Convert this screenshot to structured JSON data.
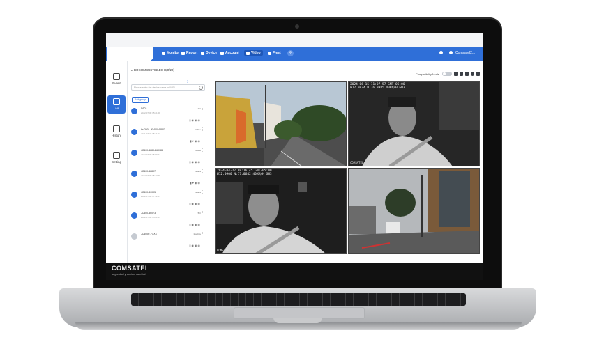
{
  "nav": {
    "items": [
      {
        "label": "Monitor",
        "icon": "monitor-icon"
      },
      {
        "label": "Report",
        "icon": "report-icon"
      },
      {
        "label": "Device",
        "icon": "device-icon"
      },
      {
        "label": "Account",
        "icon": "account-icon"
      },
      {
        "label": "Video",
        "icon": "video-icon",
        "active": true
      },
      {
        "label": "Fleet",
        "icon": "fleet-icon"
      }
    ],
    "user": "Comsatel2...",
    "accent": "#2f6fd8"
  },
  "rail": {
    "items": [
      {
        "label": "Event",
        "icon": "event-icon"
      },
      {
        "label": "Live",
        "icon": "live-icon",
        "active": true
      },
      {
        "label": "History",
        "icon": "history-icon"
      },
      {
        "label": "Setting",
        "icon": "setting-icon"
      }
    ]
  },
  "panel": {
    "title": "BOCOMBUSTIBLES H(0/20)",
    "search_placeholder": "Please enter the device name or IMEI",
    "add_group": "Add group",
    "devices": [
      {
        "name": "D302",
        "date": "2022-07-30 15:21:08",
        "status": "2hr"
      },
      {
        "name": "hrz2001-JC400-48843",
        "date": "2021-07-27 15:11:44",
        "status": "Offline"
      },
      {
        "name": "JC400-48804-60088",
        "date": "2022-07-30 15:59:21",
        "status": "Online"
      },
      {
        "name": "JC400-48807",
        "date": "2022-07-30 15:43:38",
        "status": "5days"
      },
      {
        "name": "JC400-80005",
        "date": "2022-07-30 17:42:07",
        "status": "5days"
      },
      {
        "name": "JC400-46073",
        "date": "2022-07-30 15:21:05",
        "status": "5hr"
      },
      {
        "name": "JC400P-YXXX",
        "date": "",
        "status": "Inactive"
      }
    ]
  },
  "video": {
    "compat_label": "Compatibility Mode",
    "watermark": "COMSATEL",
    "tiles": [
      {
        "timestamp": "",
        "label": "street-front"
      },
      {
        "timestamp": "2024-06-15 11:07:57 GMT-05:00\nW12.0874 N:76.9985 40KM/H GH3",
        "label": "driver-cabin"
      },
      {
        "timestamp": "2024-04-27 09:16:45 GMT-05:00\nW12.0900 N:77.0642 40KM/H GH3",
        "label": "driver-cabin"
      },
      {
        "timestamp": "",
        "label": "street-front"
      }
    ]
  },
  "brand": {
    "logo": "COMSATEL",
    "tagline": "seguridad y control satelital"
  }
}
